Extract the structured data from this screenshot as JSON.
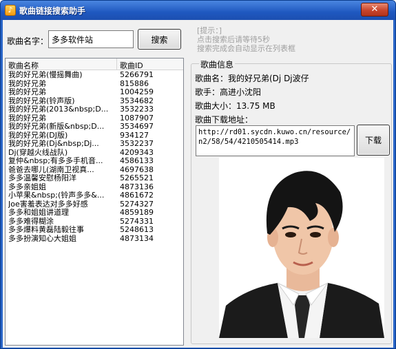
{
  "window": {
    "title": "歌曲链接搜索助手",
    "close_glyph": "✕"
  },
  "search": {
    "label": "歌曲名字：",
    "value": "多多软件站",
    "button": "搜索"
  },
  "hint": {
    "lines": [
      "[提示：]",
      "点击搜索后请等待5秒",
      "搜索完成会自动显示在列表框"
    ]
  },
  "list": {
    "headers": {
      "name": "歌曲名称",
      "id": "歌曲ID"
    },
    "rows": [
      {
        "name": "我的好兄弟(慢摇舞曲)",
        "id": "5266791"
      },
      {
        "name": "我的好兄弟",
        "id": "815886"
      },
      {
        "name": "我的好兄弟",
        "id": "1004259"
      },
      {
        "name": "我的好兄弟(铃声版)",
        "id": "3534682"
      },
      {
        "name": "我的好兄弟(2013&nbsp;D...",
        "id": "3532233"
      },
      {
        "name": "我的好兄弟",
        "id": "1087907"
      },
      {
        "name": "我的好兄弟(新版&nbsp;D...",
        "id": "3534697"
      },
      {
        "name": "我的好兄弟(DJ版)",
        "id": "934127"
      },
      {
        "name": "我的好兄弟(Dj&nbsp;Dj...",
        "id": "3532237"
      },
      {
        "name": "Dj(穿越火线战队)",
        "id": "4209343"
      },
      {
        "name": "复仲&nbsp;有多多手机音...",
        "id": "4586133"
      },
      {
        "name": "爸爸去哪儿(湖南卫视真...",
        "id": "4697638"
      },
      {
        "name": "多多温馨安慰杨阳洋",
        "id": "5265521"
      },
      {
        "name": "多多亲姐姐",
        "id": "4873136"
      },
      {
        "name": "小苹果&nbsp;(铃声多多&...",
        "id": "4861672"
      },
      {
        "name": "Joe害羞表达对多多好感",
        "id": "5274327"
      },
      {
        "name": "多多和姐姐讲道理",
        "id": "4859189"
      },
      {
        "name": "多多难得糊涂",
        "id": "5274331"
      },
      {
        "name": "多多爆料黄磊陆毅往事",
        "id": "5248613"
      },
      {
        "name": "多多扮演知心大姐姐",
        "id": "4873134"
      }
    ]
  },
  "info": {
    "group_title": "歌曲信息",
    "song_name": "歌曲名：我的好兄弟(Dj Dj波仔",
    "singer": "歌手：高进小沈阳",
    "size": "歌曲大小：13.75 MB",
    "download_label": "歌曲下载地址：",
    "url": "http://rd01.sycdn.kuwo.cn/resource/n2/58/54/4210505414.mp3",
    "download_button": "下载"
  },
  "colors": {
    "title_bar": "#2a66c8",
    "hint_text": "#a0a0a0",
    "client_bg": "#f0f0f0"
  }
}
